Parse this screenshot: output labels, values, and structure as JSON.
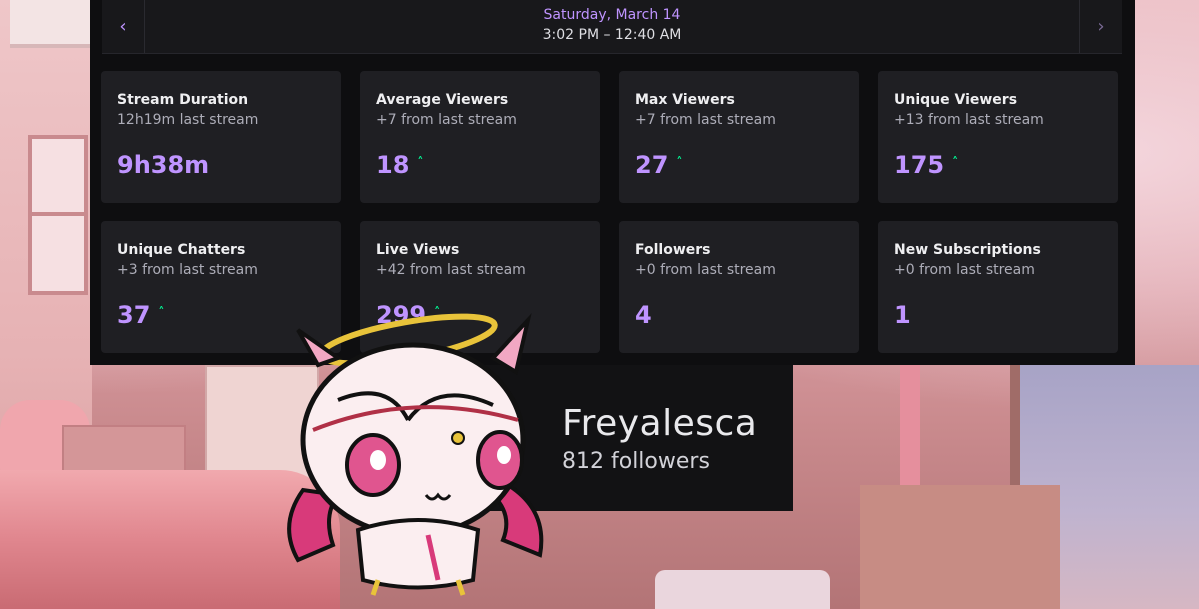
{
  "datebar": {
    "prev_icon": "chevron-left-icon",
    "next_icon": "chevron-right-icon",
    "day": "Saturday, March 14",
    "time_range": "3:02 PM – 12:40 AM"
  },
  "stats": [
    {
      "title": "Stream Duration",
      "sub": "12h19m last stream",
      "value": "9h38m",
      "trend": ""
    },
    {
      "title": "Average Viewers",
      "sub": "+7 from last stream",
      "value": "18",
      "trend": "up"
    },
    {
      "title": "Max Viewers",
      "sub": "+7 from last stream",
      "value": "27",
      "trend": "up"
    },
    {
      "title": "Unique Viewers",
      "sub": "+13 from last stream",
      "value": "175",
      "trend": "up"
    },
    {
      "title": "Unique Chatters",
      "sub": "+3 from last stream",
      "value": "37",
      "trend": "up"
    },
    {
      "title": "Live Views",
      "sub": "+42 from last stream",
      "value": "299",
      "trend": "up"
    },
    {
      "title": "Followers",
      "sub": "+0 from last stream",
      "value": "4",
      "trend": ""
    },
    {
      "title": "New Subscriptions",
      "sub": "+0 from last stream",
      "value": "1",
      "trend": ""
    }
  ],
  "trend_glyph": "˄",
  "overlay": {
    "name": "Freyalesca",
    "followers": "812 followers"
  },
  "colors": {
    "accent": "#bf94ff",
    "up": "#00f593",
    "panel_bg": "#0e0e10",
    "card_bg": "#1f1f23"
  }
}
